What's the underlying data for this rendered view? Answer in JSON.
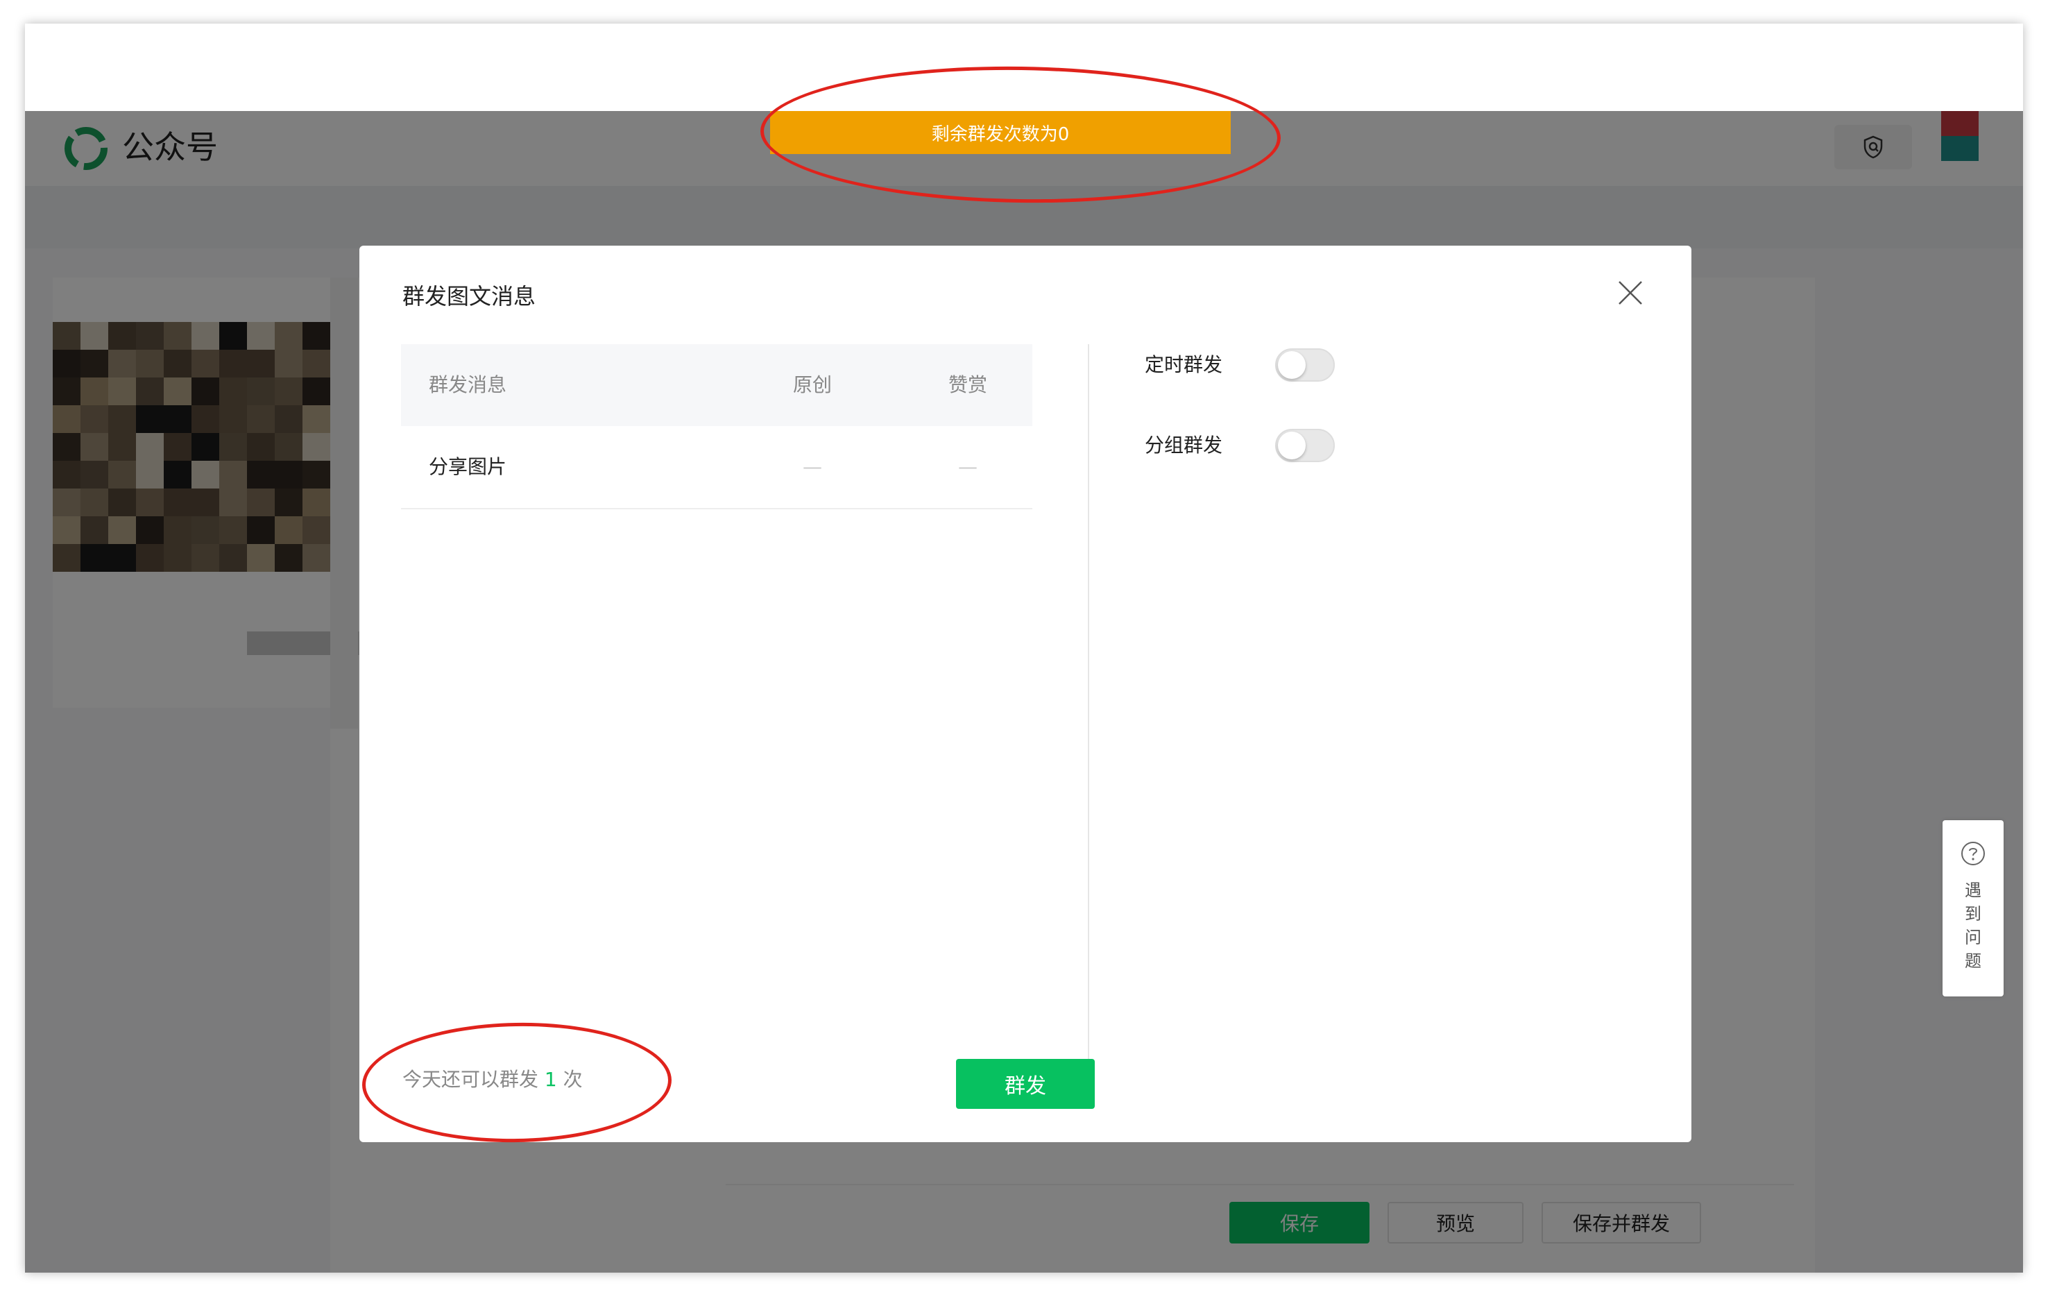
{
  "app": {
    "logo_text": "公众号"
  },
  "toast": {
    "text": "剩余群发次数为0",
    "color": "#f0a000"
  },
  "help_widget": {
    "text": "遇到问题"
  },
  "editor": {
    "buttons": {
      "save": "保存",
      "preview": "预览",
      "save_and_send": "保存并群发"
    }
  },
  "modal": {
    "title": "群发图文消息",
    "table": {
      "headers": [
        "群发消息",
        "原创",
        "赞赏"
      ],
      "rows": [
        {
          "message": "分享图片",
          "original": "—",
          "reward": "—"
        }
      ]
    },
    "options": [
      {
        "label": "定时群发",
        "enabled": false
      },
      {
        "label": "分组群发",
        "enabled": false
      }
    ],
    "remaining": {
      "prefix": "今天还可以群发 ",
      "count": "1",
      "suffix": " 次"
    },
    "send_button": "群发"
  },
  "colors": {
    "accent_green": "#07c160",
    "annotation_red": "#e0231c"
  }
}
